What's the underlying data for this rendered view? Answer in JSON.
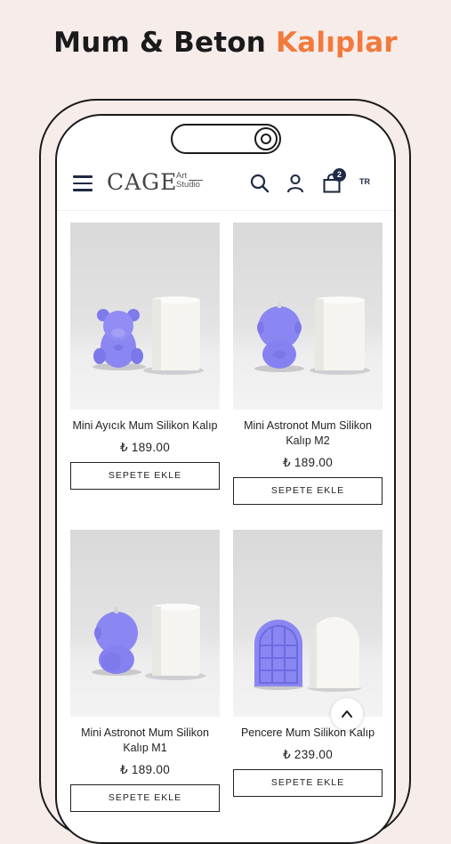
{
  "banner": {
    "title_main": "Mum & Beton",
    "title_accent": "Kalıplar",
    "accent_color": "#f27a3c"
  },
  "header": {
    "logo_main": "CAGE",
    "logo_sub_line1": "Art",
    "logo_sub_line2": "Studio",
    "cart_count": "2",
    "language": "TR",
    "icons": [
      "menu-icon",
      "search-icon",
      "user-icon",
      "shopping-bag-icon"
    ]
  },
  "products": [
    {
      "name": "Mini Ayıcık Mum Silikon Kalıp",
      "price": "₺ 189.00",
      "button": "SEPETE EKLE"
    },
    {
      "name": "Mini Astronot Mum Silikon Kalıp M2",
      "price": "₺ 189.00",
      "button": "SEPETE EKLE"
    },
    {
      "name": "Mini Astronot Mum Silikon Kalıp M1",
      "price": "₺ 189.00",
      "button": "SEPETE EKLE"
    },
    {
      "name": "Pencere Mum Silikon Kalıp",
      "price": "₺ 239.00",
      "button": "SEPETE EKLE"
    }
  ],
  "colors": {
    "product_purple": "#8a86f2",
    "candle_white": "#f5f4f0",
    "navy": "#1f2a44"
  }
}
